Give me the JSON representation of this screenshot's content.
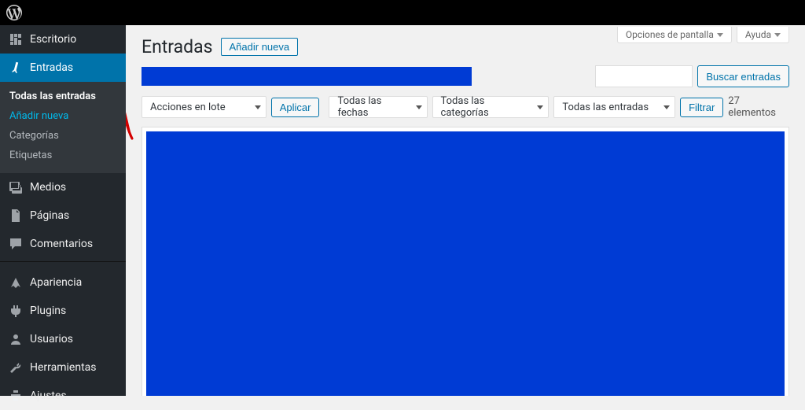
{
  "toolbar": {
    "logo": "wordpress"
  },
  "sidebar": {
    "items": [
      {
        "icon": "dashboard",
        "label": "Escritorio"
      },
      {
        "icon": "pin",
        "label": "Entradas",
        "current": true,
        "submenu": [
          {
            "label": "Todas las entradas",
            "current": true
          },
          {
            "label": "Añadir nueva",
            "highlight": true
          },
          {
            "label": "Categorías"
          },
          {
            "label": "Etiquetas"
          }
        ]
      },
      {
        "icon": "media",
        "label": "Medios"
      },
      {
        "icon": "page",
        "label": "Páginas"
      },
      {
        "icon": "comment",
        "label": "Comentarios"
      },
      {
        "sep": true
      },
      {
        "icon": "appearance",
        "label": "Apariencia"
      },
      {
        "icon": "plugin",
        "label": "Plugins"
      },
      {
        "icon": "users",
        "label": "Usuarios"
      },
      {
        "icon": "tools",
        "label": "Herramientas"
      },
      {
        "icon": "settings",
        "label": "Ajustes"
      }
    ]
  },
  "screen_meta": {
    "options": "Opciones de pantalla",
    "help": "Ayuda"
  },
  "page": {
    "title": "Entradas",
    "add_new": "Añadir nueva",
    "search_button": "Buscar entradas",
    "search_value": "",
    "count_label": "27 elementos"
  },
  "filters": {
    "bulk_actions": "Acciones en lote",
    "apply": "Aplicar",
    "dates": "Todas las fechas",
    "categories": "Todas las categorías",
    "all_entries": "Todas las entradas",
    "filter": "Filtrar"
  },
  "annotation": {
    "red_arrow": true
  }
}
